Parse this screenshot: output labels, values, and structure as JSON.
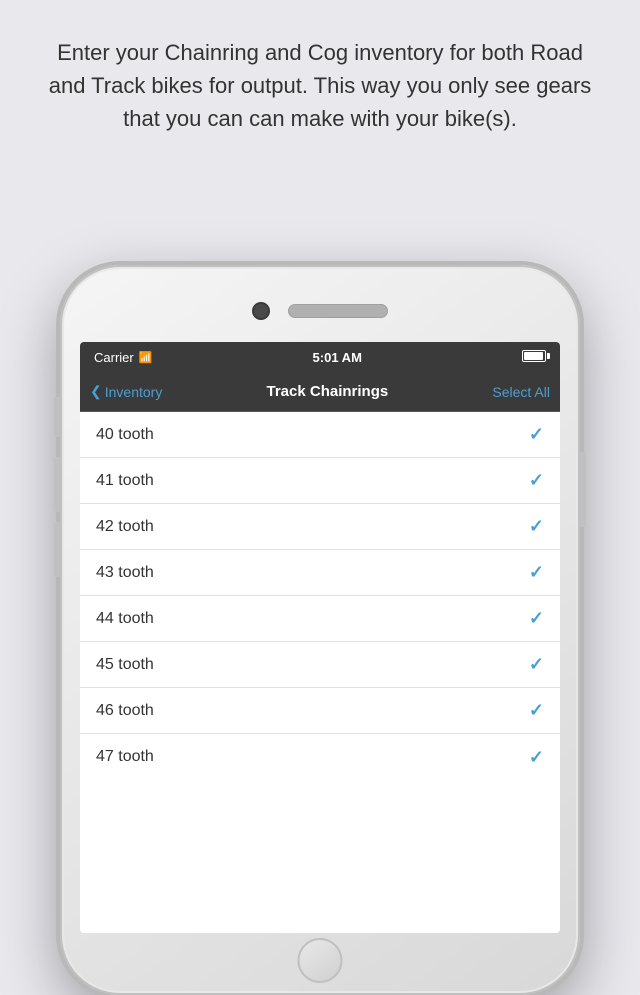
{
  "intro": {
    "text": "Enter your Chainring and Cog inventory for both Road and Track bikes for output. This way you only see gears that you can can make with your bike(s)."
  },
  "status_bar": {
    "carrier": "Carrier",
    "time": "5:01 AM"
  },
  "nav": {
    "back_label": "Inventory",
    "title": "Track Chainrings",
    "action_label": "Select All"
  },
  "list_items": [
    {
      "label": "40 tooth",
      "checked": true
    },
    {
      "label": "41 tooth",
      "checked": true
    },
    {
      "label": "42 tooth",
      "checked": true
    },
    {
      "label": "43 tooth",
      "checked": true
    },
    {
      "label": "44 tooth",
      "checked": true
    },
    {
      "label": "45 tooth",
      "checked": true
    },
    {
      "label": "46 tooth",
      "checked": true
    },
    {
      "label": "47 tooth",
      "checked": true
    }
  ],
  "icons": {
    "back_chevron": "❮",
    "checkmark": "✓",
    "wifi": "▲"
  }
}
